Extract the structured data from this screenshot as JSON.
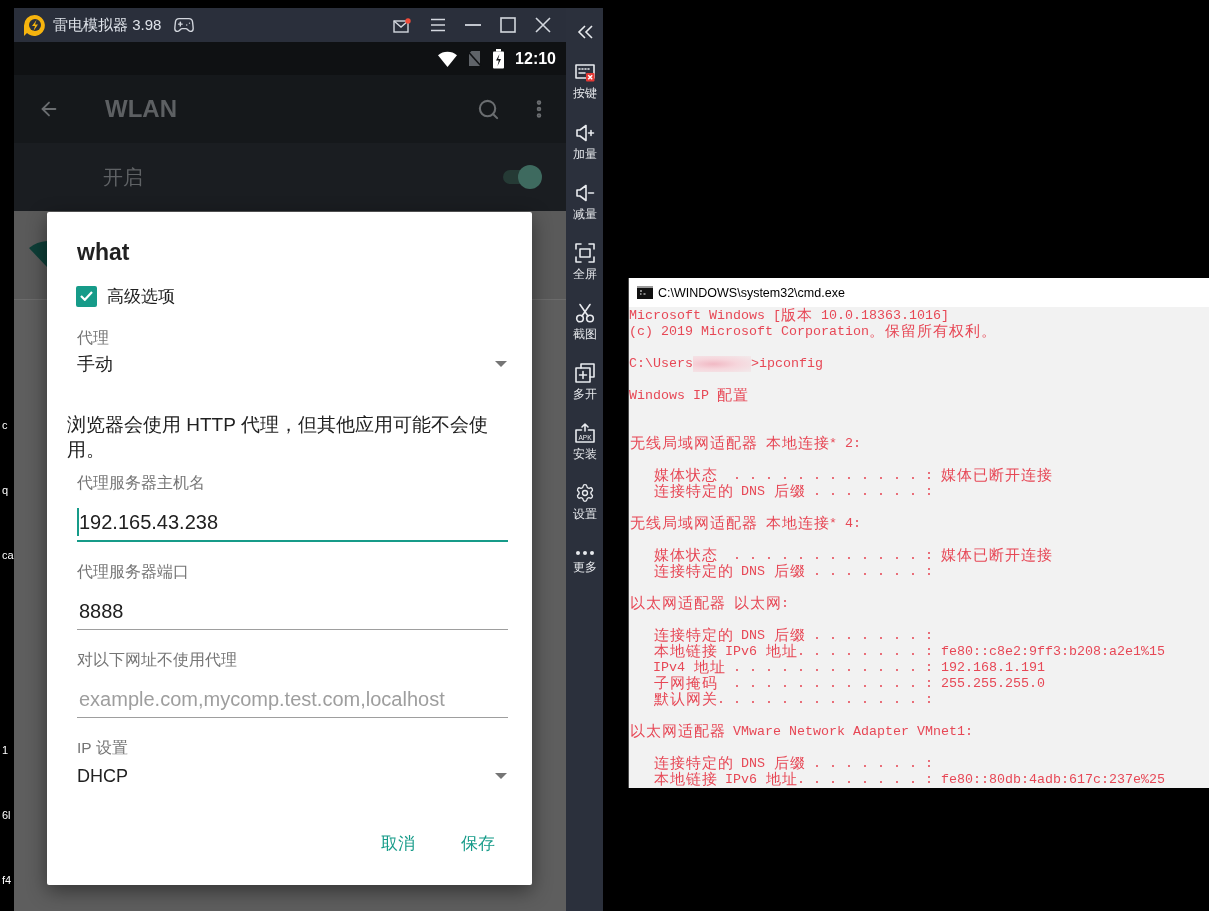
{
  "left_edge_fragments": [
    [
      "c",
      "q",
      "ca"
    ],
    [
      "1",
      "6l",
      "f4"
    ]
  ],
  "emulator": {
    "title": "雷电模拟器 3.98",
    "mail_unread": true,
    "sidebar": [
      {
        "kind": "keymap",
        "label": "按键"
      },
      {
        "kind": "volume_up",
        "label": "加量"
      },
      {
        "kind": "volume_down",
        "label": "减量"
      },
      {
        "kind": "fullscreen",
        "label": "全屏"
      },
      {
        "kind": "screenshot",
        "label": "截图"
      },
      {
        "kind": "multi_instance",
        "label": "多开"
      },
      {
        "kind": "install",
        "label": "安装",
        "icon_text": "APK"
      },
      {
        "kind": "settings",
        "label": "设置"
      },
      {
        "kind": "more",
        "label": "更多"
      }
    ]
  },
  "android": {
    "status_bar": {
      "time": "12:10"
    },
    "toolbar": {
      "title": "WLAN"
    },
    "wlan_switch": {
      "label": "开启",
      "on": true
    }
  },
  "dialog": {
    "title": "what",
    "advanced_options": {
      "label": "高级选项",
      "checked": true
    },
    "proxy": {
      "label": "代理",
      "value": "手动"
    },
    "note": "浏览器会使用 HTTP 代理，但其他应用可能不会使用。",
    "fields": [
      {
        "label": "代理服务器主机名",
        "value": "192.165.43.238",
        "focused": true
      },
      {
        "label": "代理服务器端口",
        "value": "8888",
        "focused": false
      },
      {
        "label": "对以下网址不使用代理",
        "placeholder": "example.com,mycomp.test.com,localhost",
        "focused": false
      }
    ],
    "ip_settings": {
      "label": "IP 设置",
      "value": "DHCP"
    },
    "buttons": [
      "取消",
      "保存"
    ]
  },
  "console": {
    "title": "C:\\WINDOWS\\system32\\cmd.exe",
    "banner": [
      "Microsoft Windows [版本 10.0.18363.1016]",
      "(c) 2019 Microsoft Corporation。保留所有权利。"
    ],
    "prompt": {
      "path": "C:\\Users",
      "command": ">ipconfig"
    },
    "heading": "Windows IP 配置",
    "adapters": [
      {
        "name": "无线局域网适配器 本地连接* 2:",
        "entries": [
          "媒体状态  . . . . . . . . . . . . : 媒体已断开连接",
          "连接特定的 DNS 后缀 . . . . . . . :"
        ]
      },
      {
        "name": "无线局域网适配器 本地连接* 4:",
        "entries": [
          "媒体状态  . . . . . . . . . . . . : 媒体已断开连接",
          "连接特定的 DNS 后缀 . . . . . . . :"
        ]
      },
      {
        "name": "以太网适配器 以太网:",
        "entries": [
          "连接特定的 DNS 后缀 . . . . . . . :",
          "本地链接 IPv6 地址. . . . . . . . : fe80::c8e2:9ff3:b208:a2e1%15",
          "IPv4 地址 . . . . . . . . . . . . : 192.168.1.191",
          "子网掩码  . . . . . . . . . . . . : 255.255.255.0",
          "默认网关. . . . . . . . . . . . . :"
        ]
      },
      {
        "name": "以太网适配器 VMware Network Adapter VMnet1:",
        "entries": [
          "连接特定的 DNS 后缀 . . . . . . . :",
          "本地链接 IPv6 地址. . . . . . . . : fe80::80db:4adb:617c:237e%25"
        ]
      }
    ]
  }
}
